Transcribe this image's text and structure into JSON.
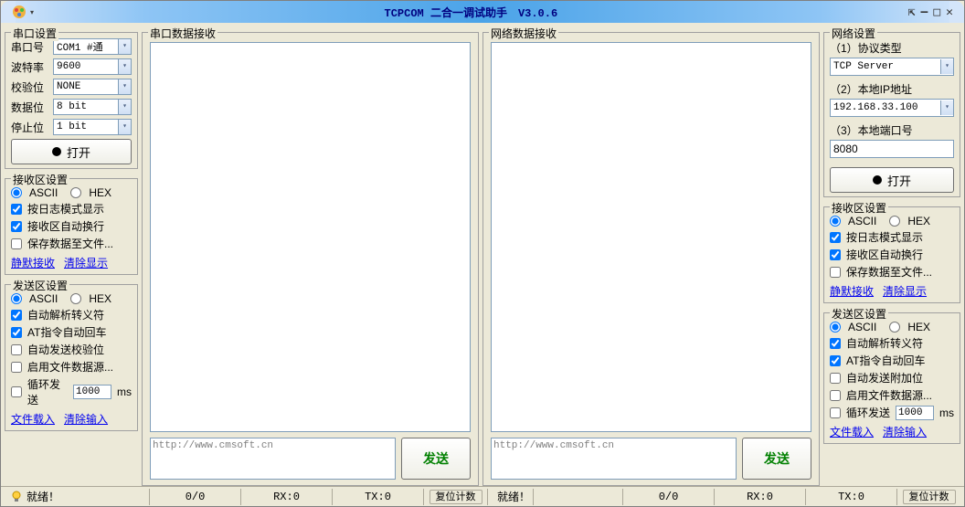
{
  "window": {
    "title": "TCPCOM 二合一调试助手　V3.0.6"
  },
  "serial": {
    "group_title": "串口设置",
    "port_label": "串口号",
    "port_value": "COM1 #通",
    "baud_label": "波特率",
    "baud_value": "9600",
    "parity_label": "校验位",
    "parity_value": "NONE",
    "databits_label": "数据位",
    "databits_value": "8 bit",
    "stopbits_label": "停止位",
    "stopbits_value": "1 bit",
    "open_button": "打开"
  },
  "recv_settings_left": {
    "group_title": "接收区设置",
    "ascii": "ASCII",
    "hex": "HEX",
    "log_mode": "按日志模式显示",
    "auto_wrap": "接收区自动换行",
    "save_file": "保存数据至文件...",
    "silent": "静默接收",
    "clear": "清除显示"
  },
  "send_settings_left": {
    "group_title": "发送区设置",
    "ascii": "ASCII",
    "hex": "HEX",
    "parse_escape": "自动解析转义符",
    "at_enter": "AT指令自动回车",
    "auto_checksum": "自动发送校验位",
    "file_source": "启用文件数据源...",
    "loop_send": "循环发送",
    "loop_interval": "1000",
    "loop_unit": "ms",
    "file_load": "文件载入",
    "clear_input": "清除输入"
  },
  "center_left": {
    "recv_title": "串口数据接收",
    "send_placeholder": "http://www.cmsoft.cn",
    "send_button": "发送"
  },
  "center_right": {
    "recv_title": "网络数据接收",
    "send_placeholder": "http://www.cmsoft.cn",
    "send_button": "发送"
  },
  "network": {
    "group_title": "网络设置",
    "protocol_label": "（1）协议类型",
    "protocol_value": "TCP Server",
    "ip_label": "（2）本地IP地址",
    "ip_value": "192.168.33.100",
    "port_label": "（3）本地端口号",
    "port_value": "8080",
    "open_button": "打开"
  },
  "recv_settings_right": {
    "group_title": "接收区设置",
    "ascii": "ASCII",
    "hex": "HEX",
    "log_mode": "按日志模式显示",
    "auto_wrap": "接收区自动换行",
    "save_file": "保存数据至文件...",
    "silent": "静默接收",
    "clear": "清除显示"
  },
  "send_settings_right": {
    "group_title": "发送区设置",
    "ascii": "ASCII",
    "hex": "HEX",
    "parse_escape": "自动解析转义符",
    "at_enter": "AT指令自动回车",
    "auto_append": "自动发送附加位",
    "file_source": "启用文件数据源...",
    "loop_send": "循环发送",
    "loop_interval": "1000",
    "loop_unit": "ms",
    "file_load": "文件载入",
    "clear_input": "清除输入"
  },
  "status": {
    "ready": "就绪！",
    "counter": "0/0",
    "rx": "RX:0",
    "tx": "TX:0",
    "reset": "复位计数"
  }
}
